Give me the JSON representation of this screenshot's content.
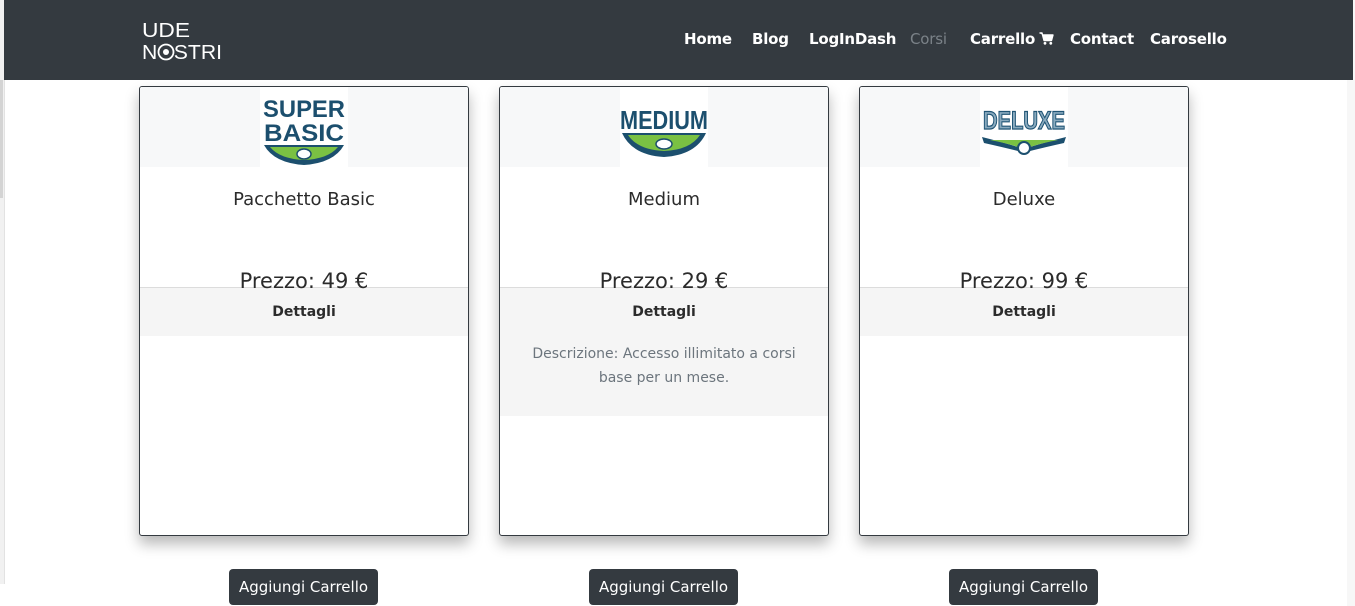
{
  "brand": {
    "line1": "UDE",
    "line2": "NOSTRI"
  },
  "nav": {
    "items": [
      {
        "label": "Home"
      },
      {
        "label": "Blog"
      },
      {
        "label": "LogInDash"
      },
      {
        "label": "Corsi",
        "active": true
      },
      {
        "label": "Carrello",
        "icon": "cart-icon"
      },
      {
        "label": "Contact"
      },
      {
        "label": "Carosello"
      }
    ]
  },
  "cards": [
    {
      "logo": {
        "icon": "super-basic-logo",
        "line1": "SUPER",
        "line2": "BASIC"
      },
      "title": "Pacchetto Basic",
      "price": "Prezzo: 49 €",
      "details_label": "Dettagli",
      "description": "",
      "add_label": "Aggiungi Carrello"
    },
    {
      "logo": {
        "icon": "medium-logo",
        "line1": "MEDIUM"
      },
      "title": "Medium",
      "price": "Prezzo: 29 €",
      "details_label": "Dettagli",
      "description": "Descrizione: Accesso illimitato a corsi base per un mese.",
      "add_label": "Aggiungi Carrello"
    },
    {
      "logo": {
        "icon": "deluxe-logo",
        "line1": "DELUXE"
      },
      "title": "Deluxe",
      "price": "Prezzo: 99 €",
      "details_label": "Dettagli",
      "description": "",
      "add_label": "Aggiungi Carrello"
    }
  ],
  "colors": {
    "navbar": "#343a40",
    "logo_blue": "#1c4f6e",
    "logo_green": "#7ac143",
    "button": "#343a40"
  }
}
